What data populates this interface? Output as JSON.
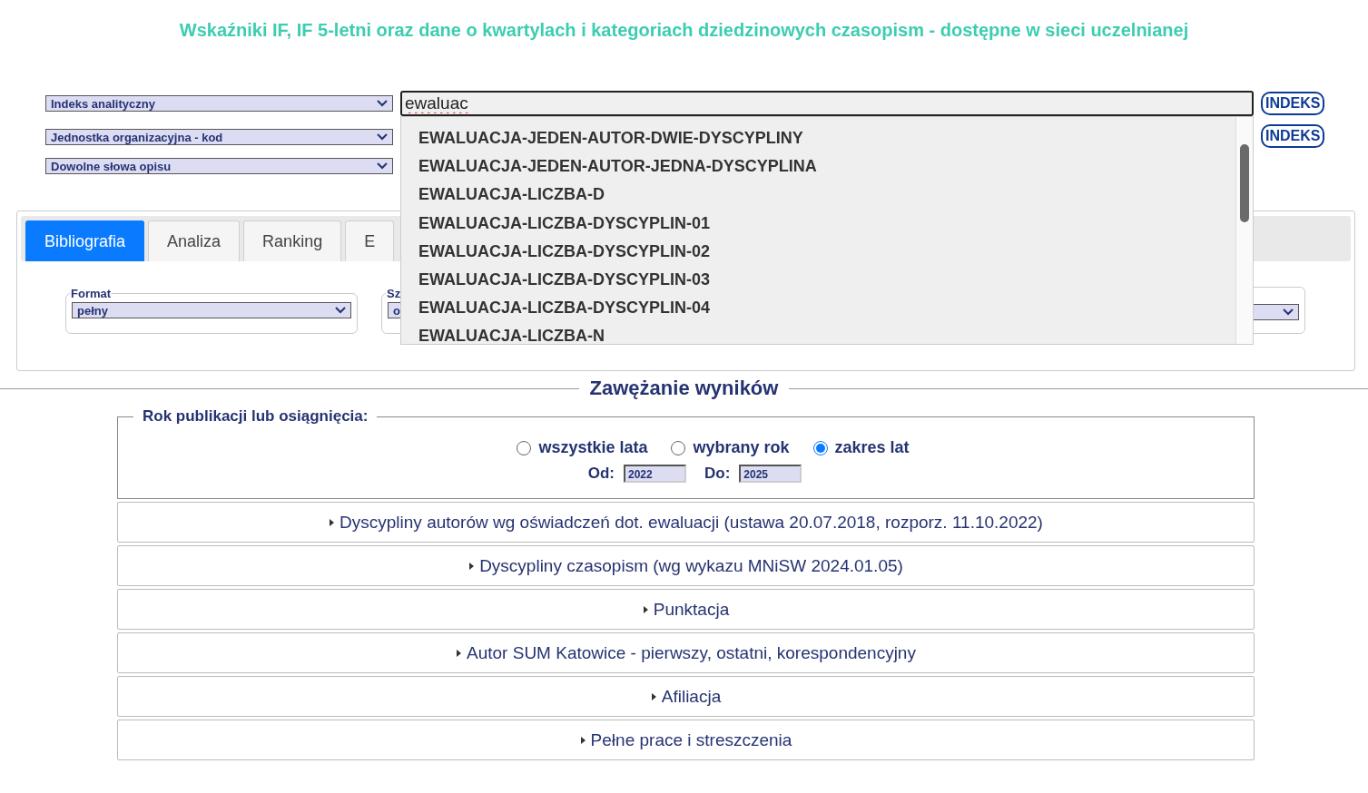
{
  "title": "Wskaźniki IF, IF 5-letni oraz dane o kwartylach i kategoriach dziedzinowych czasopism - dostępne w sieci uczelnianej",
  "search_rows": [
    {
      "field": "Indeks analityczny",
      "button": "INDEKS"
    },
    {
      "field": "Jednostka organizacyjna - kod",
      "button": "INDEKS"
    },
    {
      "field": "Dowolne słowa opisu"
    }
  ],
  "search_input": {
    "value": "ewaluac"
  },
  "suggestions": [
    "EWALUACJA-JEDEN-AUTOR-DWIE-DYSCYPLINY",
    "EWALUACJA-JEDEN-AUTOR-JEDNA-DYSCYPLINA",
    "EWALUACJA-LICZBA-D",
    "EWALUACJA-LICZBA-DYSCYPLIN-01",
    "EWALUACJA-LICZBA-DYSCYPLIN-02",
    "EWALUACJA-LICZBA-DYSCYPLIN-03",
    "EWALUACJA-LICZBA-DYSCYPLIN-04",
    "EWALUACJA-LICZBA-N"
  ],
  "tabs": [
    {
      "label": "Bibliografia",
      "selected": true
    },
    {
      "label": "Analiza",
      "selected": false
    },
    {
      "label": "Ranking",
      "selected": false
    },
    {
      "label": "E",
      "selected": false
    }
  ],
  "options": [
    {
      "kind": "select",
      "legend": "Format",
      "value": "pełny"
    },
    {
      "kind": "select",
      "legend": "Sz",
      "value": "o"
    },
    {
      "kind": "select"
    }
  ],
  "narrowing": {
    "heading": "Zawężanie wyników",
    "year": {
      "legend": "Rok publikacji lub osiągnięcia:",
      "radios": [
        {
          "label": "wszystkie lata",
          "selected": false
        },
        {
          "label": "wybrany rok",
          "selected": false
        },
        {
          "label": "zakres lat",
          "selected": true
        }
      ],
      "from_label": "Od:",
      "from": "2022",
      "to_label": "Do:",
      "to": "2025"
    },
    "sections": [
      {
        "label": "Dyscypliny autorów wg oświadczeń dot. ewaluacji (ustawa 20.07.2018, rozporz. 11.10.2022)",
        "expanded": false
      },
      {
        "label": "Dyscypliny czasopism (wg wykazu MNiSW 2024.01.05)",
        "expanded": false
      },
      {
        "label": "Punktacja",
        "expanded": false
      },
      {
        "label": "Autor SUM Katowice - pierwszy, ostatni, korespondencyjny",
        "expanded": false
      },
      {
        "label": "Afiliacja",
        "expanded": false
      },
      {
        "label": "Pełne prace i streszczenia",
        "expanded": false
      }
    ]
  }
}
